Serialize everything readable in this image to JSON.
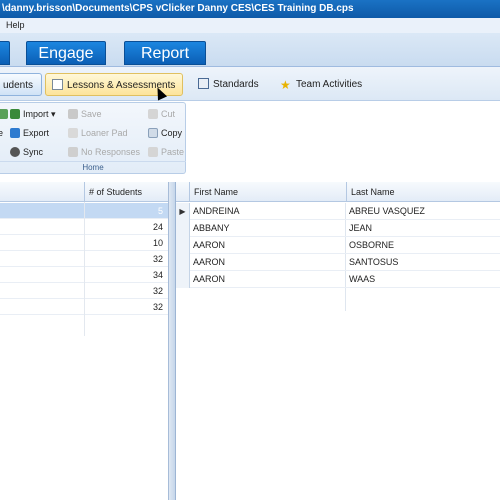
{
  "window": {
    "title": "\\danny.brisson\\Documents\\CPS vClicker Danny CES\\CES Training DB.cps"
  },
  "menu": {
    "help": "Help"
  },
  "nav": {
    "engage": "Engage",
    "report": "Report"
  },
  "tabs": [
    {
      "label": "udents"
    },
    {
      "label": "Lessons & Assessments"
    },
    {
      "label": "Standards"
    },
    {
      "label": "Team Activities"
    }
  ],
  "ribbon": {
    "import": "Import",
    "export": "Export",
    "sync": "Sync",
    "save": "Save",
    "loaner_pad": "Loaner Pad",
    "no_responses": "No Responses",
    "cut": "Cut",
    "copy": "Copy",
    "paste": "Paste",
    "group_label": "Home"
  },
  "classes": {
    "count_header": "# of Students",
    "rows": [
      {
        "count": "5"
      },
      {
        "count": "24"
      },
      {
        "count": "10"
      },
      {
        "count": "32"
      },
      {
        "count": "34"
      },
      {
        "count": "32"
      },
      {
        "count": "32"
      }
    ]
  },
  "students": {
    "first_header": "First Name",
    "last_header": "Last Name",
    "rows": [
      {
        "first": "ANDREINA",
        "last": "ABREU VASQUEZ"
      },
      {
        "first": "ABBANY",
        "last": "JEAN"
      },
      {
        "first": "AARON",
        "last": "OSBORNE"
      },
      {
        "first": "AARON",
        "last": "SANTOSUS"
      },
      {
        "first": "AARON",
        "last": "WAAS"
      }
    ]
  },
  "colors": {
    "accent": "#0b5fb5",
    "selection": "#c3d9f3",
    "tab_highlight": "#fde49a"
  }
}
